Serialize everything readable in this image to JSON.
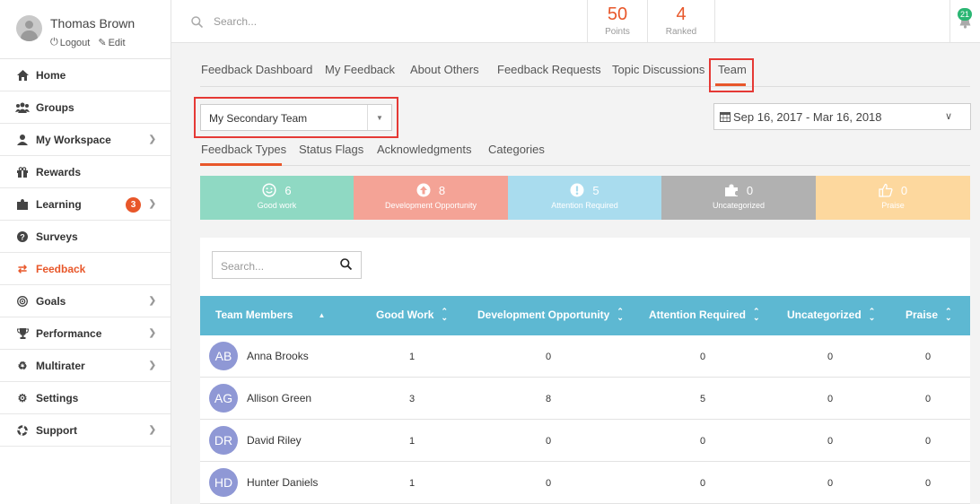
{
  "user": {
    "name": "Thomas Brown",
    "logout": "Logout",
    "edit": "Edit"
  },
  "sidebar": {
    "items": [
      {
        "label": "Home",
        "icon": "home-icon"
      },
      {
        "label": "Groups",
        "icon": "users-icon"
      },
      {
        "label": "My Workspace",
        "icon": "user-icon"
      },
      {
        "label": "Rewards",
        "icon": "gift-icon"
      },
      {
        "label": "Learning",
        "icon": "puzzle-icon",
        "badge": "3"
      },
      {
        "label": "Surveys",
        "icon": "question-icon"
      },
      {
        "label": "Feedback",
        "icon": "exchange-icon"
      },
      {
        "label": "Goals",
        "icon": "target-icon"
      },
      {
        "label": "Performance",
        "icon": "trophy-icon"
      },
      {
        "label": "Multirater",
        "icon": "recycle-icon"
      },
      {
        "label": "Settings",
        "icon": "gear-icon"
      },
      {
        "label": "Support",
        "icon": "lifebuoy-icon"
      }
    ]
  },
  "topbar": {
    "search_placeholder": "Search...",
    "points_value": "50",
    "points_label": "Points",
    "ranked_value": "4",
    "ranked_label": "Ranked",
    "notifications": "21"
  },
  "tabs": [
    "Feedback Dashboard",
    "My Feedback",
    "About Others",
    "Feedback Requests",
    "Topic Discussions",
    "Team"
  ],
  "team_select": {
    "value": "My Secondary Team"
  },
  "date_range": {
    "value": "Sep 16, 2017 - Mar 16, 2018"
  },
  "subtabs": [
    "Feedback Types",
    "Status Flags",
    "Acknowledgments",
    "Categories"
  ],
  "cards": [
    {
      "count": "6",
      "label": "Good work",
      "color": "#8fd9c3",
      "icon": "smile-icon"
    },
    {
      "count": "8",
      "label": "Development Opportunity",
      "color": "#f4a396",
      "icon": "arrow-up-circle-icon"
    },
    {
      "count": "5",
      "label": "Attention Required",
      "color": "#a9dcee",
      "icon": "exclamation-circle-icon"
    },
    {
      "count": "0",
      "label": "Uncategorized",
      "color": "#b1b1b1",
      "icon": "puzzle-icon"
    },
    {
      "count": "0",
      "label": "Praise",
      "color": "#fdd89e",
      "icon": "thumbs-up-icon"
    }
  ],
  "table": {
    "search_placeholder": "Search...",
    "headers": [
      "Team Members",
      "Good Work",
      "Development Opportunity",
      "Attention Required",
      "Uncategorized",
      "Praise"
    ],
    "rows": [
      {
        "initials": "AB",
        "name": "Anna Brooks",
        "values": [
          "1",
          "0",
          "0",
          "0",
          "0"
        ]
      },
      {
        "initials": "AG",
        "name": "Allison Green",
        "values": [
          "3",
          "8",
          "5",
          "0",
          "0"
        ]
      },
      {
        "initials": "DR",
        "name": "David Riley",
        "values": [
          "1",
          "0",
          "0",
          "0",
          "0"
        ]
      },
      {
        "initials": "HD",
        "name": "Hunter Daniels",
        "values": [
          "1",
          "0",
          "0",
          "0",
          "0"
        ]
      }
    ]
  }
}
